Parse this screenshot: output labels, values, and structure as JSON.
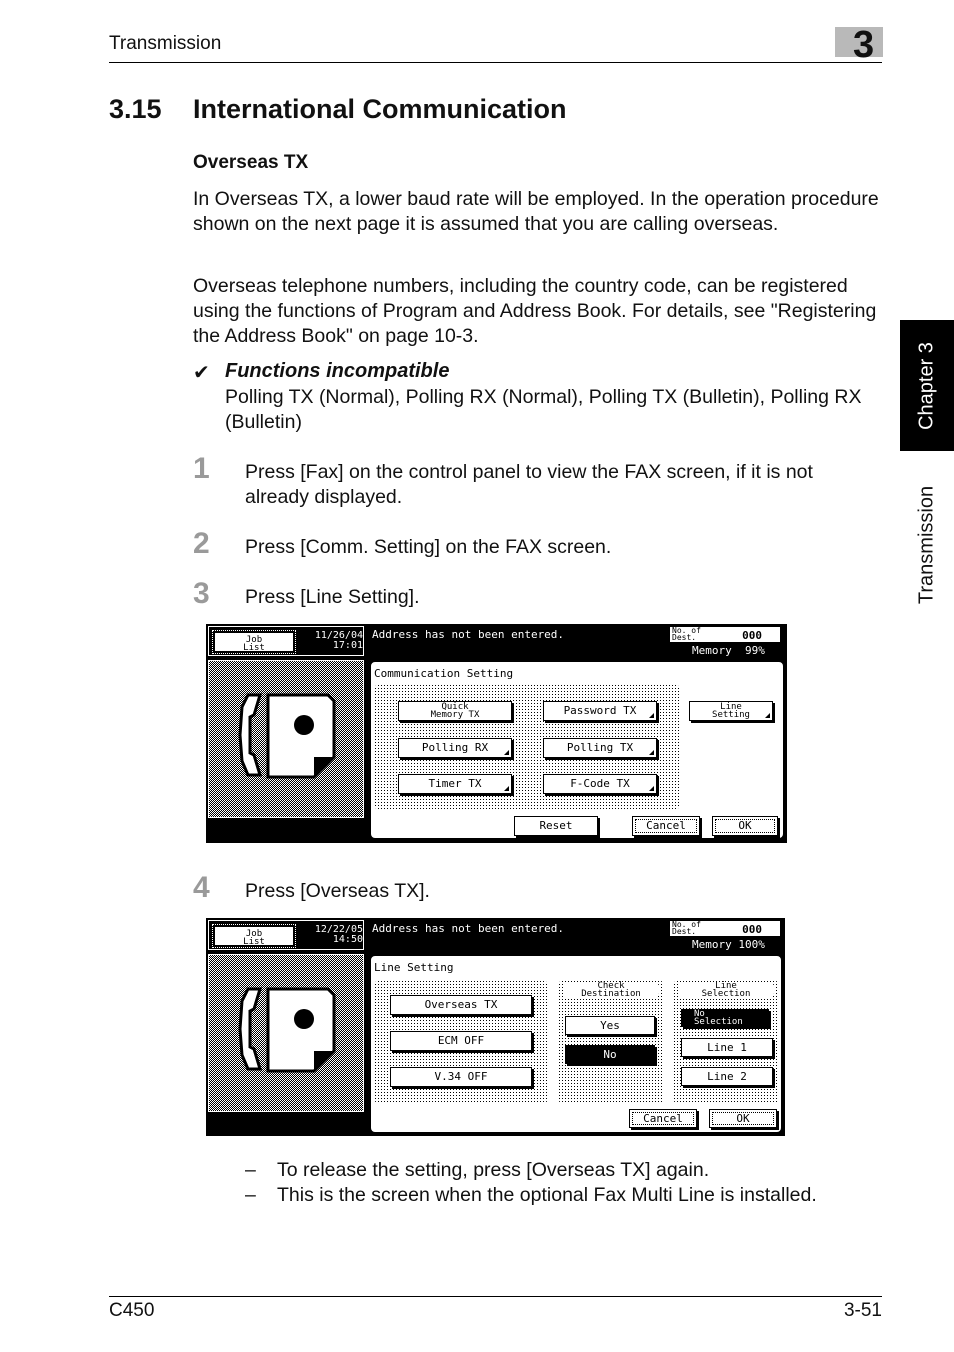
{
  "header": {
    "section": "Transmission",
    "chapter_number": "3"
  },
  "side_tabs": {
    "chapter": "Chapter 3",
    "section": "Transmission"
  },
  "heading": {
    "number": "3.15",
    "title": "International Communication"
  },
  "subheading": "Overseas TX",
  "paragraphs": [
    "In Overseas TX, a lower baud rate will be employed. In the operation procedure shown on the next page it is assumed that you are calling overseas.",
    "Overseas telephone numbers, including the country code, can be registered using the functions of Program and Address Book. For details, see \"Registering the Address Book\" on page 10-3."
  ],
  "incompatible": {
    "icon": "check-mark-icon",
    "glyph": "✔",
    "title": "Functions incompatible",
    "body": "Polling TX (Normal), Polling RX (Normal), Polling TX (Bulletin), Polling RX (Bulletin)"
  },
  "steps": [
    {
      "num": "1",
      "text": "Press [Fax] on the control panel to view the FAX screen, if it is not already displayed."
    },
    {
      "num": "2",
      "text": "Press [Comm. Setting] on the FAX screen."
    },
    {
      "num": "3",
      "text": "Press [Line Setting]."
    },
    {
      "num": "4",
      "text": "Press [Overseas TX]."
    }
  ],
  "screen1": {
    "job_list": "Job\nList",
    "date": "11/26/04",
    "time": "17:01",
    "message": "Address has not been entered.",
    "dest_label": "No. of\nDest.",
    "dest_value": "000",
    "memory": "Memory  99%",
    "title": "Communication Setting",
    "buttons": {
      "quick_memory": "Quick\nMemory TX",
      "password_tx": "Password TX",
      "line_setting": "Line\nSetting",
      "polling_rx": "Polling RX",
      "polling_tx": "Polling TX",
      "timer_tx": "Timer TX",
      "fcode_tx": "F-Code TX",
      "reset": "Reset",
      "cancel": "Cancel",
      "ok": "OK"
    }
  },
  "screen2": {
    "job_list": "Job\nList",
    "date": "12/22/05",
    "time": "14:50",
    "message": "Address has not been entered.",
    "dest_label": "No. of\nDest.",
    "dest_value": "000",
    "memory": "Memory 100%",
    "title": "Line Setting",
    "buttons": {
      "overseas_tx": "Overseas TX",
      "ecm_off": "ECM OFF",
      "v34_off": "V.34 OFF",
      "cancel": "Cancel",
      "ok": "OK"
    },
    "check_destination": {
      "label": "Check\nDestination",
      "yes": "Yes",
      "no": "No",
      "selected": "No"
    },
    "line_selection": {
      "label": "Line\nSelection",
      "no_selection": "No\nSelection",
      "line1": "Line 1",
      "line2": "Line 2",
      "selected": "No Selection"
    }
  },
  "notes": [
    "To release the setting, press [Overseas TX] again.",
    "This is the screen when the optional Fax Multi Line is installed."
  ],
  "note_dash": "–",
  "footer": {
    "model": "C450",
    "page": "3-51"
  }
}
